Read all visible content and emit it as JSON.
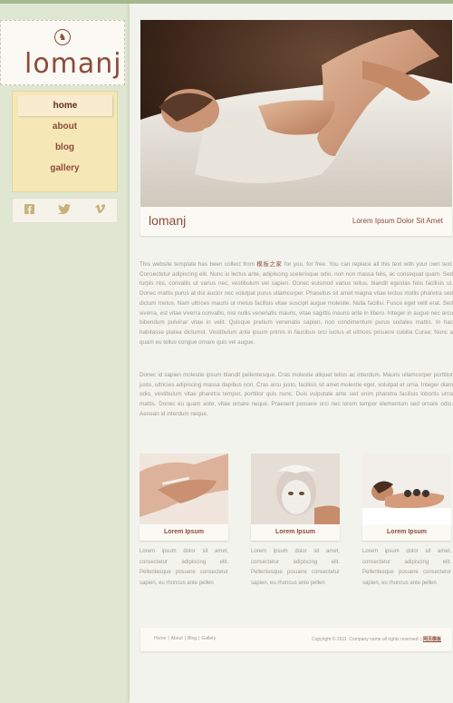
{
  "brand": {
    "logo_text": "lomanj"
  },
  "nav": {
    "items": [
      {
        "label": "home",
        "active": true
      },
      {
        "label": "about",
        "active": false
      },
      {
        "label": "blog",
        "active": false
      },
      {
        "label": "gallery",
        "active": false
      }
    ]
  },
  "social": {
    "icons": [
      "facebook-icon",
      "twitter-icon",
      "vimeo-icon"
    ]
  },
  "hero": {
    "logo_text": "lomanj",
    "caption_title": "Lorem Ipsum Dolor Sit Amet"
  },
  "content": {
    "para1_before_link": "This website template has been collect from ",
    "para1_link": "模板之家",
    "para1_after_link": " for you, for free. You can replace all this text with your own text. Consectetur adipiscing elit. Nunc iu lectus ante, adipiscing scelerisque odio, non non massa felis, ac consequat quam. Sed turpis nisi, convallis ut varius nec, vestibulum vel sapien. Donec euismod varius tellus, blandit egestas felis facilisis ut. Donec mattis purus at dui auctor nec volutpat purus ullamcorper. Phasellus sit amet magna vitae lectus mollis pharetra sed dictum metus. Nam ultrices mauris ut metus facilisis vitae suscipit augue molestie. Nulla facilisi. Fusce eget velit erat. Sed viverra, est vitae viverra convallis, nisi nullis venenatis mauris, vitae sagittis mauris ante in libero. Integer in augue nec arcu bibendum pulvinar vitae in velit. Quisque pretium venenatis sapien, non condimentum purus sodales mattis. In hac habitasse platea dictumst. Vestibulum ante ipsum primis in faucibus orci luctus et ultrices posuere cubilia Curae; Nunc a quam eu tellus congue ornare quis vel augue.",
    "para2": "Donec id sapien molestie ipsum blandit pellentesque. Cras molestie aliquet tellus ac interdum. Mauris ullamcorper porttitor justo, ultricies adipiscing massa dapibus non. Cras arcu justo, facilisis sit amet molestie eget, volutpat et urna. Integer diam odio, vestibulum vitae pharetra tempor, porttitor quis nunc. Duis vulputate ante sed enim pharetra facilisis lobortis urna mattis. Donec eu quam ante, vitae ornare neque. Praesent posuere orci nec lorem tempor elementum sed ornare odio. Aenean id interdum neque."
  },
  "cards": [
    {
      "title": "Lorem Ipsum",
      "text": "Lorem ipsum dolor sit amet, consectetur adipiscing elit. Pellentesque posuere consectetur sapien, eu rhoncus ante pellen"
    },
    {
      "title": "Lorem Ipsum",
      "text": "Lorem ipsum dolor sit amet, consectetur adipiscing elit. Pellentesque posuere consectetur sapien, eu rhoncus ante pellen"
    },
    {
      "title": "Lorem Ipsum",
      "text": "Lorem ipsum dolor sit amet, consectetur adipiscing elit. Pellentesque posuere consectetur sapien, eu rhoncus ante pellen"
    }
  ],
  "footer": {
    "links": [
      "Home",
      "About",
      "Blog",
      "Gallery"
    ],
    "copyright": "Copyright © 2011. Company name all rights reserved.",
    "copyright_link": "网页模板"
  },
  "colors": {
    "accent": "#8c4b3c",
    "nav_bg": "#f6e7b7",
    "page_bg": "#d9e3cd"
  }
}
